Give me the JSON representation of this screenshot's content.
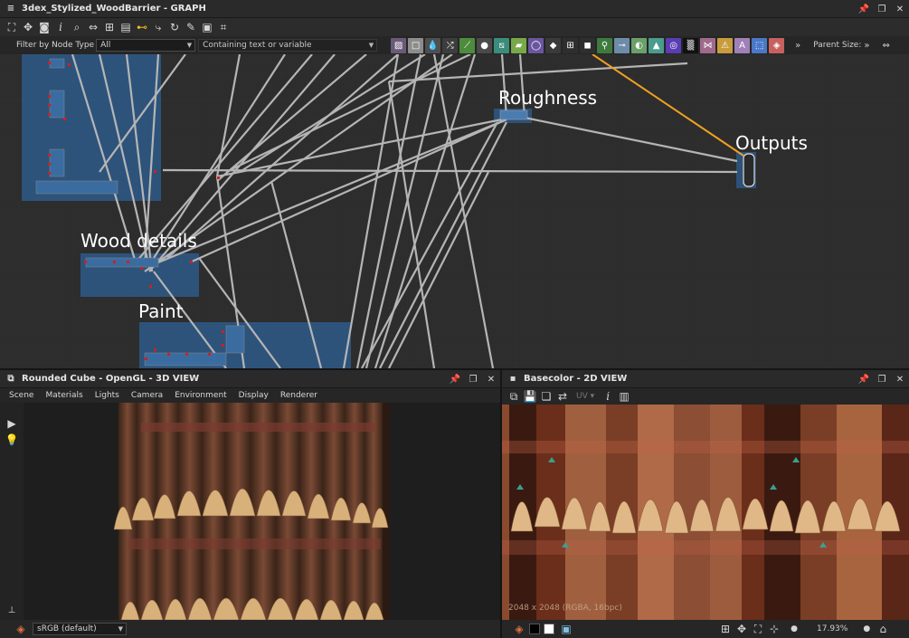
{
  "graph": {
    "title": "3dex_Stylized_WoodBarrier - GRAPH",
    "filter_label": "Filter by Node Type",
    "filter_value": "All",
    "search_placeholder": "Containing text or variable",
    "parent_size_label": "Parent Size:",
    "frames": {
      "roughness": "Roughness",
      "outputs": "Outputs",
      "wood_details": "Wood details",
      "paint": "Paint"
    }
  },
  "view3d": {
    "title": "Rounded Cube - OpenGL - 3D VIEW",
    "menu": [
      "Scene",
      "Materials",
      "Lights",
      "Camera",
      "Environment",
      "Display",
      "Renderer"
    ],
    "colorspace": "sRGB (default)"
  },
  "view2d": {
    "title": "Basecolor - 2D VIEW",
    "uv_label": "UV",
    "info_overlay": "2048 x 2048 (RGBA, 16bpc)",
    "zoom": "17.93%"
  },
  "colors": {
    "frame_blue": "#2e5a8a",
    "accent_orange": "#f0a020",
    "wire_grey": "#b5b5b5"
  },
  "icons": {
    "graph_toolbar": [
      "fit-icon",
      "pan-icon",
      "camera-icon",
      "info-icon",
      "search-icon",
      "link-icon",
      "align-icon",
      "align-center-icon",
      "connect-icon",
      "route-icon",
      "refresh-icon",
      "tools-icon",
      "frame-icon",
      "crop-icon"
    ],
    "node_palette": [
      "image-input-icon",
      "uniform-color-icon",
      "levels-icon",
      "shuffle-icon",
      "curve-icon",
      "blur-icon",
      "warp-icon",
      "gradient-icon",
      "transform-icon",
      "sphere-icon",
      "tile-icon",
      "blend-icon",
      "fx-map-icon",
      "normal-icon",
      "hsl-icon",
      "histogram-icon",
      "color-wheel-icon",
      "noise-icon",
      "pixel-processor-icon",
      "warning-icon",
      "text-icon",
      "selection-icon",
      "fill-icon"
    ]
  }
}
